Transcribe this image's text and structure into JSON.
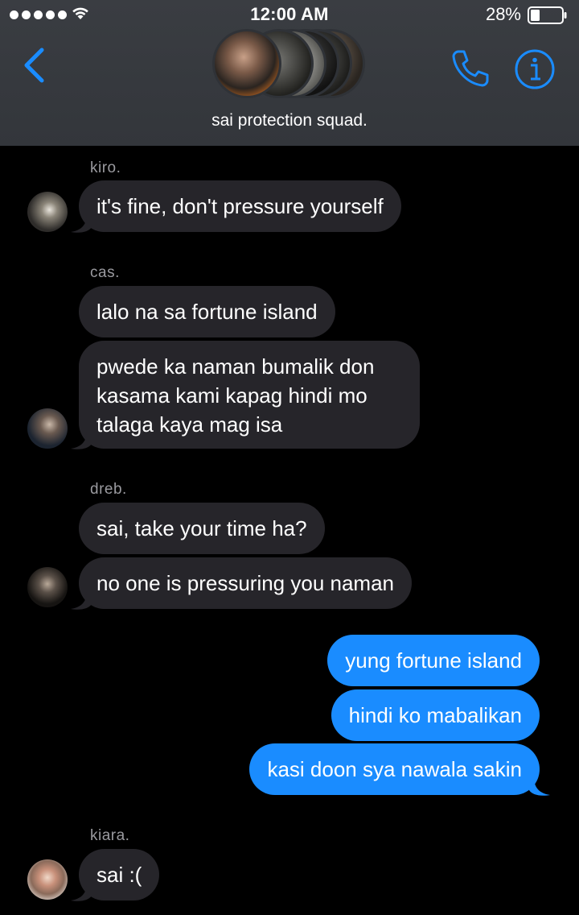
{
  "status": {
    "time": "12:00 AM",
    "battery": "28%"
  },
  "header": {
    "group_name": "sai protection squad."
  },
  "colors": {
    "accent": "#1a8cff",
    "incoming_bubble": "#26252a",
    "header_bg": "#35383d"
  },
  "messages": {
    "kiro": {
      "sender": "kiro.",
      "m1": "it's fine, don't pressure yourself"
    },
    "cas": {
      "sender": "cas.",
      "m1": "lalo na sa fortune island",
      "m2": "pwede ka naman bumalik don kasama kami kapag hindi mo talaga kaya mag isa"
    },
    "dreb": {
      "sender": "dreb.",
      "m1": "sai, take your time ha?",
      "m2": "no one is pressuring you naman"
    },
    "me": {
      "m1": "yung fortune island",
      "m2": "hindi ko mabalikan",
      "m3": "kasi doon sya nawala sakin"
    },
    "kiara": {
      "sender": "kiara.",
      "m1": "sai :("
    }
  }
}
